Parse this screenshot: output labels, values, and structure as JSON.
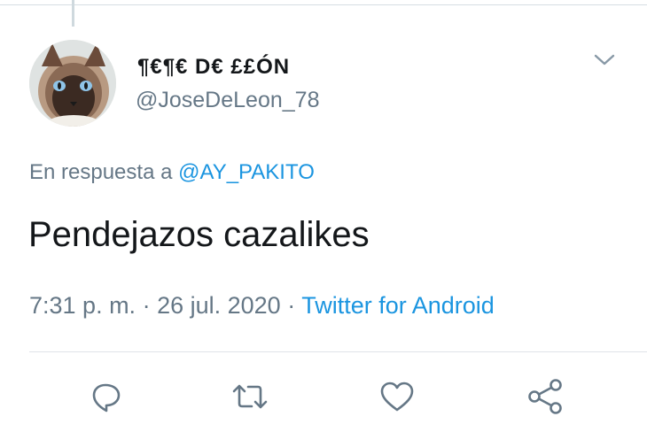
{
  "tweet": {
    "author": {
      "display_name": "¶€¶€ D€ ££ÓN",
      "handle": "@JoseDeLeon_78",
      "avatar_icon": "siamese-cat-avatar"
    },
    "reply_prefix": "En respuesta a",
    "reply_to": "@AY_PAKITO",
    "text": "Pendejazos cazalikes",
    "time": "7:31 p. m.",
    "sep1": " · ",
    "date": "26 jul. 2020",
    "sep2": " · ",
    "source": "Twitter for Android"
  },
  "actions": {
    "reply_icon": "reply-icon",
    "retweet_icon": "retweet-icon",
    "like_icon": "heart-icon",
    "share_icon": "share-icon"
  },
  "colors": {
    "text": "#14171a",
    "secondary": "#657786",
    "link": "#1b95e0",
    "icon": "#657786"
  }
}
